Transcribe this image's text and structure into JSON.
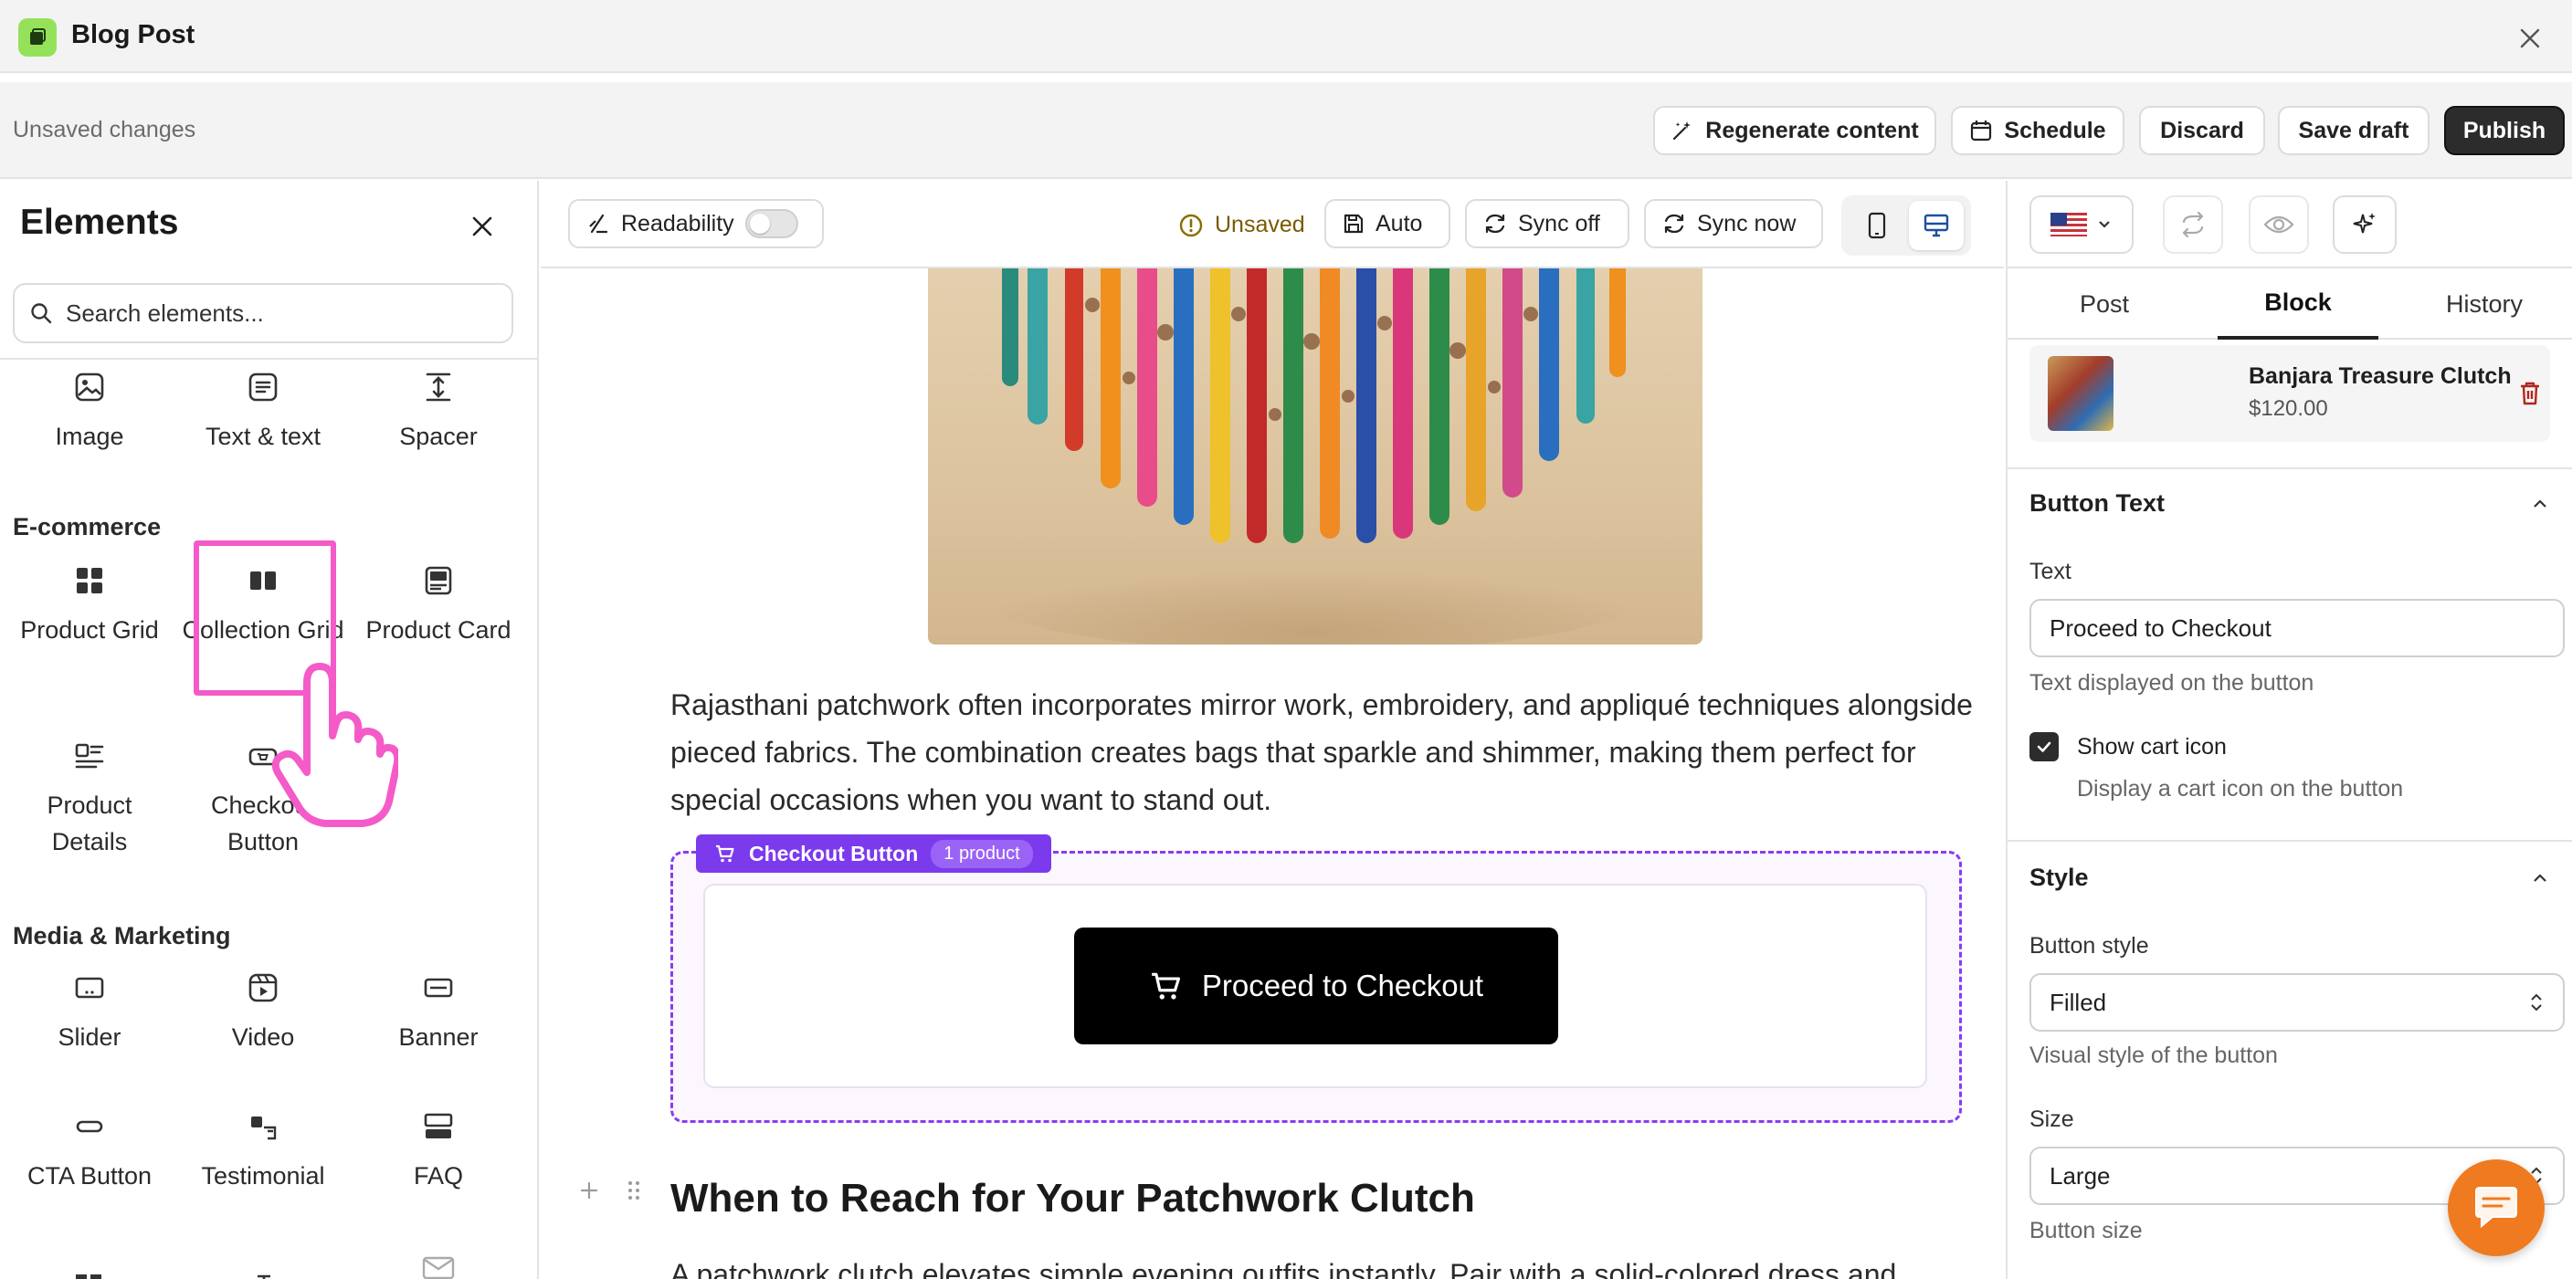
{
  "window": {
    "title": "Blog Post"
  },
  "actionbar": {
    "status": "Unsaved changes",
    "regenerate": "Regenerate content",
    "schedule": "Schedule",
    "discard": "Discard",
    "save_draft": "Save draft",
    "publish": "Publish"
  },
  "sidebar": {
    "title": "Elements",
    "search_placeholder": "Search elements...",
    "basic": [
      {
        "label": "Image",
        "icon": "image-icon"
      },
      {
        "label": "Text & text",
        "icon": "text-icon"
      },
      {
        "label": "Spacer",
        "icon": "spacer-icon"
      }
    ],
    "ecommerce_title": "E-commerce",
    "ecommerce": [
      {
        "label": "Product Grid",
        "icon": "grid-icon"
      },
      {
        "label": "Collection Grid",
        "icon": "columns-icon"
      },
      {
        "label": "Product Card",
        "icon": "card-icon"
      },
      {
        "label": "Product Details",
        "icon": "details-icon"
      },
      {
        "label": "Checkout Button",
        "icon": "checkout-icon"
      }
    ],
    "media_title": "Media & Marketing",
    "media": [
      {
        "label": "Slider",
        "icon": "slider-icon"
      },
      {
        "label": "Video",
        "icon": "video-icon"
      },
      {
        "label": "Banner",
        "icon": "banner-icon"
      },
      {
        "label": "CTA Button",
        "icon": "cta-icon"
      },
      {
        "label": "Testimonial",
        "icon": "testimonial-icon"
      },
      {
        "label": "FAQ",
        "icon": "faq-icon"
      }
    ]
  },
  "editor": {
    "readability": "Readability",
    "readability_on": false,
    "status": "Unsaved",
    "auto": "Auto",
    "sync_off": "Sync off",
    "sync_now": "Sync now",
    "paragraph": "Rajasthani patchwork often incorporates mirror work, embroidery, and appliqué techniques alongside pieced fabrics. The combination creates bags that sparkle and shimmer, making them perfect for special occasions when you want to stand out.",
    "block_tag": "Checkout Button",
    "block_count": "1 product",
    "checkout_label": "Proceed to Checkout",
    "heading": "When to Reach for Your Patchwork Clutch",
    "paragraph_2": "A patchwork clutch elevates simple evening outfits instantly. Pair with a solid-colored dress and"
  },
  "panel": {
    "tabs": [
      "Post",
      "Block",
      "History"
    ],
    "active_tab": "Block",
    "product": {
      "name": "Banjara Treasure Clutch",
      "price": "$120.00"
    },
    "button_text_section": "Button Text",
    "text_label": "Text",
    "text_value": "Proceed to Checkout",
    "text_help": "Text displayed on the button",
    "show_cart_label": "Show cart icon",
    "show_cart_checked": true,
    "show_cart_help": "Display a cart icon on the button",
    "style_section": "Style",
    "button_style_label": "Button style",
    "button_style_value": "Filled",
    "button_style_help": "Visual style of the button",
    "size_label": "Size",
    "size_value": "Large",
    "size_help": "Button size"
  },
  "colors": {
    "accent_purple": "#7c3aed",
    "highlight_pink": "#f45bc8",
    "app_green": "#95e25a",
    "chat_orange": "#f07a1f"
  }
}
